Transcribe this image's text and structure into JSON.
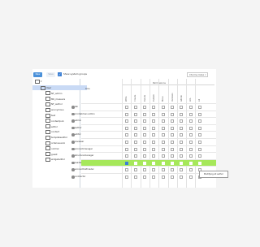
{
  "toolbar": {
    "new_label": "New",
    "save_label": "Save",
    "show_system_label": "Show system groups",
    "show_system_checked": true,
    "dropdown_value": "Chrome Index"
  },
  "tree": {
    "root_label": "",
    "items": [
      {
        "label": "User",
        "selected": true
      },
      {
        "label": "NT_admin"
      },
      {
        "label": "MK_measure"
      },
      {
        "label": "NT_author"
      },
      {
        "label": "anonymous"
      },
      {
        "label": "test"
      },
      {
        "label": "contentpub"
      },
      {
        "label": "editor"
      },
      {
        "label": "contact"
      },
      {
        "label": "templateeditor"
      },
      {
        "label": "orderusuario"
      },
      {
        "label": "normal"
      },
      {
        "label": "guest"
      },
      {
        "label": "widgeteditor"
      }
    ]
  },
  "grid": {
    "role_header": "Role",
    "permission_header": "Permissions",
    "columns": [
      "Write",
      "Create",
      "Delete",
      "Publish",
      "Move",
      "Versions",
      "Admin",
      "ACL",
      "All"
    ],
    "rows": [
      {
        "name": "lab"
      },
      {
        "name": "crontabman admin"
      },
      {
        "name": "admin"
      },
      {
        "name": "author"
      },
      {
        "name": "editor"
      },
      {
        "name": "reviewer"
      },
      {
        "name": "accountmanager"
      },
      {
        "name": "structuremanager"
      },
      {
        "name": "reader",
        "highlight": true,
        "checked": [
          0
        ]
      },
      {
        "name": "accounthalfroader"
      },
      {
        "name": "contractor"
      }
    ]
  },
  "tooltip": "Modifying  All  author"
}
